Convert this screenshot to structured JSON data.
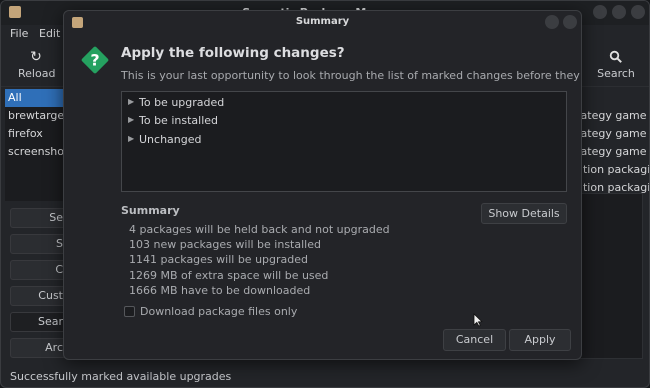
{
  "main_window": {
    "title": "Synaptic Package Manager",
    "menu": [
      "File",
      "Edit"
    ],
    "toolbar": {
      "reload_label": "Reload",
      "search_label": "Search"
    },
    "filters": [
      {
        "label": "All",
        "selected": true
      },
      {
        "label": "brewtarget",
        "selected": false
      },
      {
        "label": "firefox",
        "selected": false
      },
      {
        "label": "screenshot",
        "selected": false
      }
    ],
    "side_buttons": [
      "Se",
      "S",
      "C",
      "Cust",
      "Sear",
      "Arc"
    ],
    "package_descriptions": [
      "rategy game c",
      "rategy game c",
      "rategy game c",
      "ution packagi",
      "ution packagi"
    ],
    "status": "Successfully marked available upgrades"
  },
  "dialog": {
    "title": "Summary",
    "heading": "Apply the following changes?",
    "subtext": "This is your last opportunity to look through the list of marked changes before they are applied.",
    "tree": [
      "To be upgraded",
      "To be installed",
      "Unchanged"
    ],
    "summary_label": "Summary",
    "show_details_label": "Show Details",
    "summary_lines": [
      "4 packages will be held back and not upgraded",
      "103 new packages will be installed",
      "1141 packages will be upgraded",
      "1269 MB of extra space will be used",
      "1666 MB have to be downloaded"
    ],
    "download_only_label": "Download package files only",
    "download_only_checked": false,
    "cancel_label": "Cancel",
    "apply_label": "Apply"
  },
  "colors": {
    "accent": "#2f6fb8",
    "question_icon": "#25a160"
  },
  "icons": {
    "dialog": "question-icon",
    "reload": "reload-icon",
    "search": "search-icon"
  }
}
